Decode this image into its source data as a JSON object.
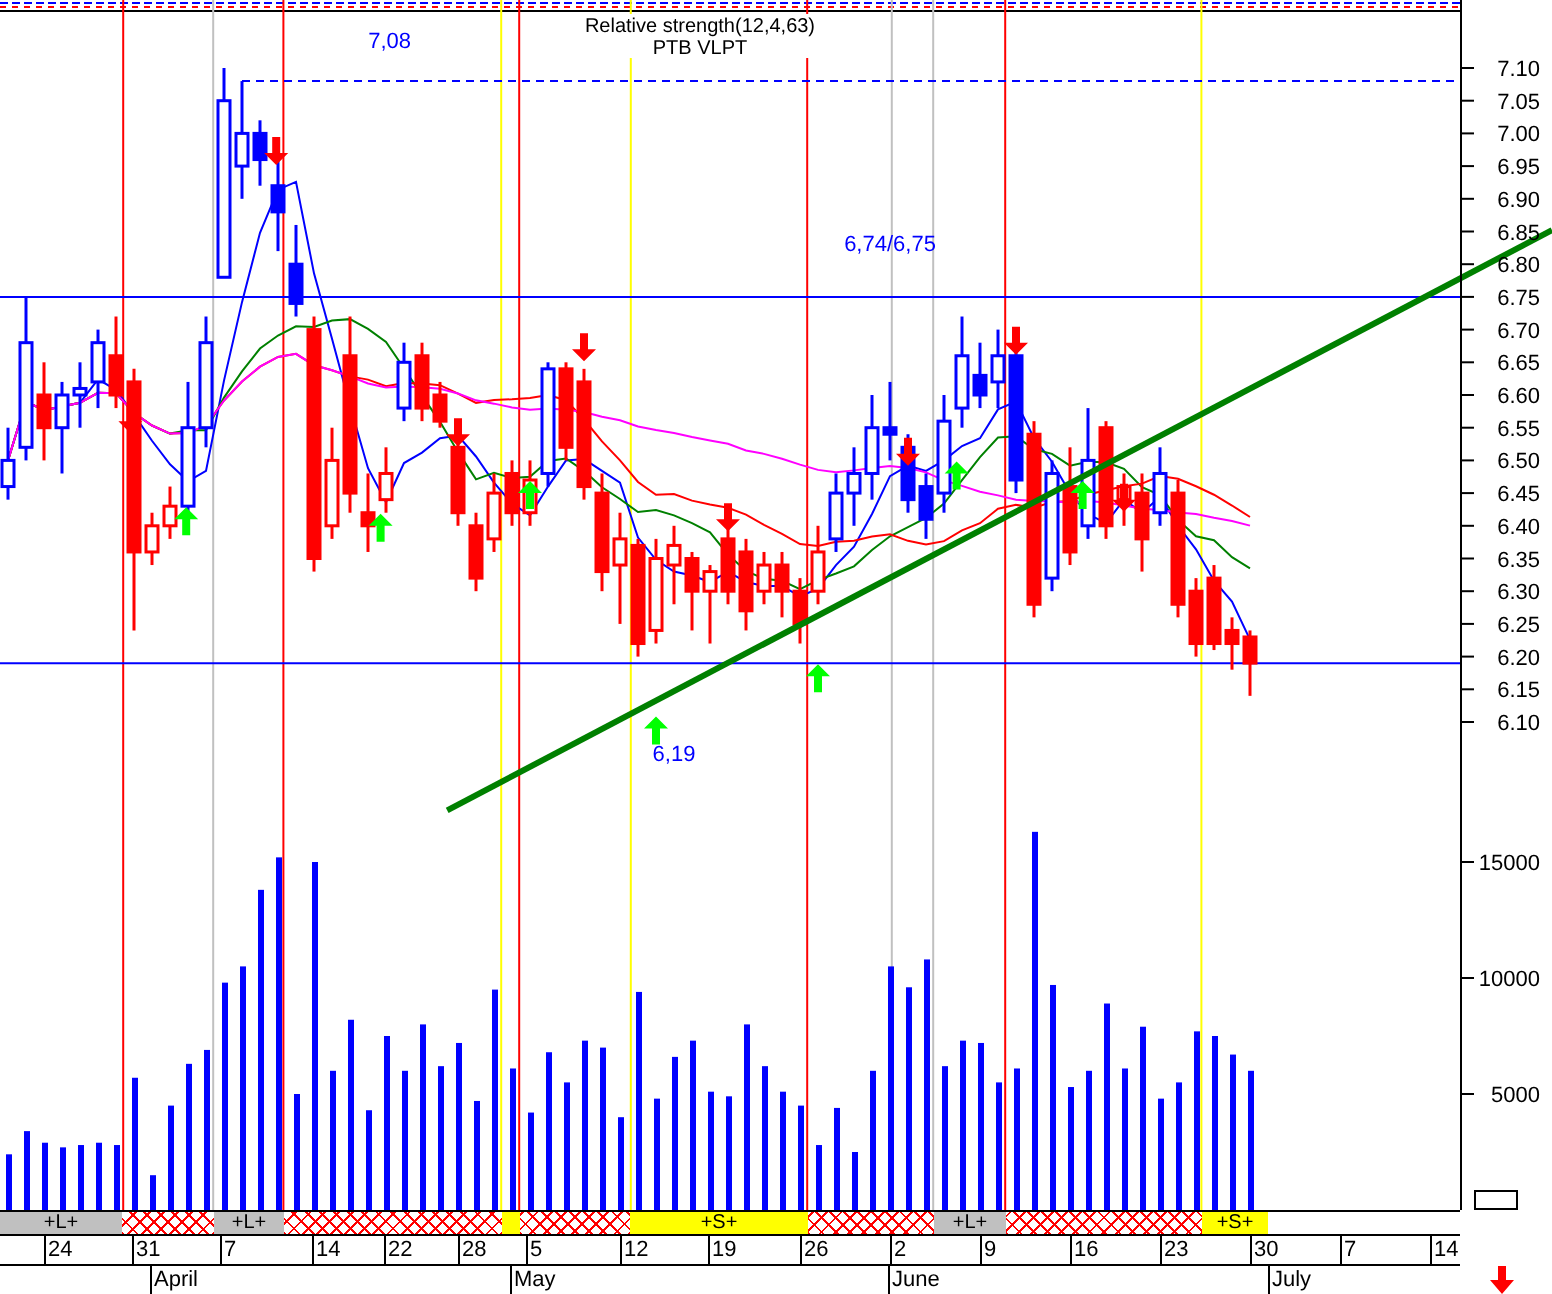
{
  "price_chart": {
    "titles": [
      "Relative strength(12,4,63)",
      "PTB VLPT"
    ],
    "labels": [
      "7,08",
      "6,74/6,75",
      "6,19"
    ],
    "axis_labels": [
      "7.10",
      "7.05",
      "7.00",
      "6.95",
      "6.90",
      "6.85",
      "6.80",
      "6.75",
      "6.70",
      "6.65",
      "6.60",
      "6.55",
      "6.50",
      "6.45",
      "6.40",
      "6.35",
      "6.30",
      "6.25",
      "6.20",
      "6.15",
      "6.10"
    ]
  },
  "volume_chart": {
    "axis_labels": [
      "15000",
      "10000",
      "5000"
    ]
  },
  "signal_band": [
    {
      "kind": "long",
      "label": "+L+"
    },
    {
      "kind": "neutral"
    },
    {
      "kind": "long",
      "label": "+L+"
    },
    {
      "kind": "neutral"
    },
    {
      "kind": "short"
    },
    {
      "kind": "neutral"
    },
    {
      "kind": "short",
      "label": "+S+"
    },
    {
      "kind": "neutral"
    },
    {
      "kind": "long",
      "label": "+L+"
    },
    {
      "kind": "neutral"
    },
    {
      "kind": "short",
      "label": "+S+"
    }
  ],
  "date_axis": {
    "days": [
      "24",
      "31",
      "7",
      "14",
      "22",
      "28",
      "5",
      "12",
      "19",
      "26",
      "2",
      "9",
      "16",
      "23",
      "30",
      "7",
      "14"
    ],
    "months": [
      "April",
      "May",
      "June",
      "July"
    ]
  }
}
